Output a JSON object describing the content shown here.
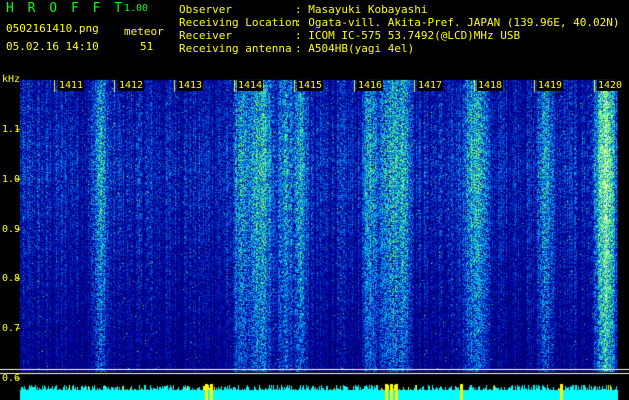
{
  "header": {
    "app_name": "H R O F F T",
    "version": "1.00",
    "filename": "0502161410.png",
    "mode": "meteor",
    "datetime": "05.02.16 14:10",
    "count": "51"
  },
  "station": [
    {
      "label": "Observer",
      "value": ": Masayuki Kobayashi"
    },
    {
      "label": "Receiving Location",
      "value": ": Ogata-vill. Akita-Pref. JAPAN (139.96E, 40.02N)"
    },
    {
      "label": "Receiver",
      "value": ": ICOM IC-575 53.7492(@LCD)MHz USB"
    },
    {
      "label": "Receiving antenna",
      "value": ": A504HB(yagi 4el)"
    }
  ],
  "spectrogram": {
    "y_unit": "kHz",
    "y_ticks": [
      "1.1",
      "1.0",
      "0.9",
      "0.8",
      "0.7",
      "0.6"
    ],
    "ylim": [
      0.58,
      1.2
    ],
    "time_marks": [
      "1411",
      "1412",
      "1413",
      "1414",
      "1415",
      "1416",
      "1417",
      "1418",
      "1419",
      "1420"
    ],
    "colors": {
      "background": "#000000",
      "labels": "#ffff00",
      "title": "#00ff00",
      "power_bar": "#00ffff"
    }
  }
}
